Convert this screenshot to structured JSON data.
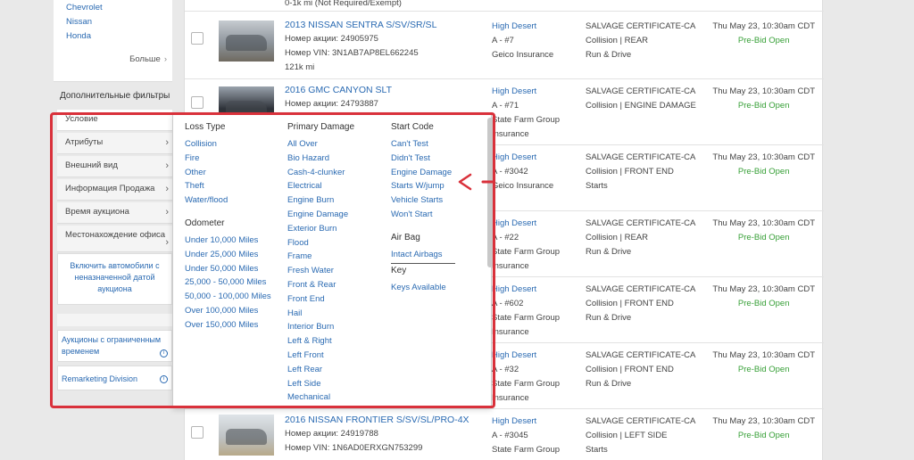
{
  "sidebar": {
    "makes": [
      "Chevrolet",
      "Nissan",
      "Honda"
    ],
    "more_label": "Больше",
    "additional_filters": "Дополнительные фильтры",
    "filters": [
      "Условие",
      "Атрибуты",
      "Внешний вид",
      "Информация Продажа",
      "Время аукциона",
      "Местонахождение офиса"
    ],
    "undated_link": "Включить автомобили с неназначенной датой аукциона",
    "limited_time_auctions": "Аукционы с ограниченным временем",
    "remarketing_division": "Remarketing Division"
  },
  "results": {
    "top_partial": "0-1k mi (Not Required/Exempt)",
    "rows": [
      {
        "title": "2013 NISSAN SENTRA S/SV/SR/SL",
        "lot": "Номер акции: 24905975",
        "vin": "Номер VIN: 3N1AB7AP8EL662245",
        "odometer": "121k mi",
        "yard": "High Desert",
        "yard_row": "A - #7",
        "seller": "Geico Insurance",
        "seller2": "",
        "doc": "SALVAGE CERTIFICATE-CA",
        "damage": "Collision | REAR",
        "cond": "Run & Drive",
        "date": "Thu May 23, 10:30am CDT",
        "status": "Pre-Bid Open"
      },
      {
        "title": "2016 GMC CANYON SLT",
        "lot": "Номер акции: 24793887",
        "vin": "",
        "odometer": "",
        "yard": "High Desert",
        "yard_row": "A - #71",
        "seller": "State Farm Group",
        "seller2": "Insurance",
        "doc": "SALVAGE CERTIFICATE-CA",
        "damage": "Collision | ENGINE DAMAGE",
        "cond": "",
        "date": "Thu May 23, 10:30am CDT",
        "status": "Pre-Bid Open"
      },
      {
        "title": "",
        "lot": "",
        "vin": "",
        "odometer": "",
        "yard": "High Desert",
        "yard_row": "A - #3042",
        "seller": "Geico Insurance",
        "seller2": "",
        "doc": "SALVAGE CERTIFICATE-CA",
        "damage": "Collision | FRONT END",
        "cond": "Starts",
        "date": "Thu May 23, 10:30am CDT",
        "status": "Pre-Bid Open"
      },
      {
        "title": "",
        "lot": "",
        "vin": "",
        "odometer": "",
        "yard": "High Desert",
        "yard_row": "A - #22",
        "seller": "State Farm Group",
        "seller2": "Insurance",
        "doc": "SALVAGE CERTIFICATE-CA",
        "damage": "Collision | REAR",
        "cond": "Run & Drive",
        "date": "Thu May 23, 10:30am CDT",
        "status": "Pre-Bid Open"
      },
      {
        "title": "",
        "lot": "",
        "vin": "",
        "odometer": "",
        "yard": "High Desert",
        "yard_row": "A - #602",
        "seller": "State Farm Group",
        "seller2": "Insurance",
        "doc": "SALVAGE CERTIFICATE-CA",
        "damage": "Collision | FRONT END",
        "cond": "Run & Drive",
        "date": "Thu May 23, 10:30am CDT",
        "status": "Pre-Bid Open"
      },
      {
        "title": "",
        "lot": "",
        "vin": "",
        "odometer": "",
        "yard": "High Desert",
        "yard_row": "A - #32",
        "seller": "State Farm Group",
        "seller2": "Insurance",
        "doc": "SALVAGE CERTIFICATE-CA",
        "damage": "Collision | FRONT END",
        "cond": "Run & Drive",
        "date": "Thu May 23, 10:30am CDT",
        "status": "Pre-Bid Open"
      },
      {
        "title": "2016 NISSAN FRONTIER S/SV/SL/PRO-4X",
        "lot": "Номер акции: 24919788",
        "vin": "Номер VIN: 1N6AD0ERXGN753299",
        "odometer": "",
        "yard": "High Desert",
        "yard_row": "A - #3045",
        "seller": "State Farm Group",
        "seller2": "",
        "doc": "SALVAGE CERTIFICATE-CA",
        "damage": "Collision | LEFT SIDE",
        "cond": "Starts",
        "date": "Thu May 23, 10:30am CDT",
        "status": "Pre-Bid Open"
      }
    ]
  },
  "popover": {
    "loss_type": {
      "heading": "Loss Type",
      "items": [
        "Collision",
        "Fire",
        "Other",
        "Theft",
        "Water/flood"
      ]
    },
    "odometer": {
      "heading": "Odometer",
      "items": [
        "Under 10,000 Miles",
        "Under 25,000 Miles",
        "Under 50,000 Miles",
        "25,000 - 50,000 Miles",
        "50,000 - 100,000 Miles",
        "Over 100,000 Miles",
        "Over 150,000 Miles"
      ]
    },
    "primary_damage": {
      "heading": "Primary Damage",
      "items": [
        "All Over",
        "Bio Hazard",
        "Cash-4-clunker",
        "Electrical",
        "Engine Burn",
        "Engine Damage",
        "Exterior Burn",
        "Flood",
        "Frame",
        "Fresh Water",
        "Front & Rear",
        "Front End",
        "Hail",
        "Interior Burn",
        "Left & Right",
        "Left Front",
        "Left Rear",
        "Left Side",
        "Mechanical"
      ]
    },
    "start_code": {
      "heading": "Start Code",
      "items": [
        "Can't Test",
        "Didn't Test",
        "Engine Damage",
        "Starts W/jump",
        "Vehicle Starts",
        "Won't Start"
      ]
    },
    "air_bag": {
      "heading": "Air Bag",
      "items": [
        "Intact Airbags"
      ]
    },
    "key": {
      "heading": "Key",
      "items": [
        "Keys Available"
      ]
    }
  },
  "colors": {
    "link": "#2a6ab2",
    "status_green": "#38a038",
    "annotation_red": "#d9313b"
  }
}
